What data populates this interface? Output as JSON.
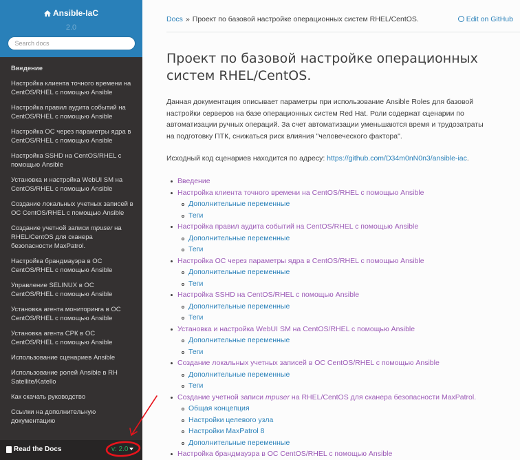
{
  "project": {
    "name": "Ansible-IaC",
    "version": "2.0"
  },
  "search": {
    "placeholder": "Search docs"
  },
  "sidebar": {
    "items": [
      {
        "label": "Введение",
        "bold": true
      },
      {
        "label": "Настройка клиента точного времени на CentOS/RHEL с помощью Ansible"
      },
      {
        "label": "Настройка правил аудита событий на CentOS/RHEL с помощью Ansible"
      },
      {
        "label": "Настройка ОС через параметры ядра в CentOS/RHEL с помощью Ansible"
      },
      {
        "label": "Настройка SSHD на CentOS/RHEL с помощью Ansible"
      },
      {
        "label": "Установка и настройка WebUI SM на CentOS/RHEL с помощью Ansible"
      },
      {
        "label": "Создание локальных учетных записей в ОС CentOS/RHEL с помощью Ansible"
      },
      {
        "label_before": "Создание учетной записи ",
        "label_em": "mpuser",
        "label_after": " на RHEL/CentOS для сканера безопасности MaxPatrol."
      },
      {
        "label": "Настройка брандмауэра в ОС CentOS/RHEL с помощью Ansible"
      },
      {
        "label": "Управление SELINUX в ОС CentOS/RHEL с помощью Ansible"
      },
      {
        "label": "Установка агента мониторинга в ОС CentOS/RHEL с помощью Ansible"
      },
      {
        "label": "Установка агента СРК в ОС CentOS/RHEL с помощью Ansible"
      },
      {
        "label": "Использование сценариев Ansible"
      },
      {
        "label": "Использование ролей Ansible в RH Satellite/Katello"
      },
      {
        "label": "Как скачать руководство"
      },
      {
        "label": "Ссылки на дополнительную документацию"
      }
    ]
  },
  "rtd": {
    "label": "Read the Docs",
    "version": "v: 2.0"
  },
  "breadcrumbs": {
    "root": "Docs",
    "separator": "»",
    "current": "Проект по базовой настройке операционных систем RHEL/CentOS."
  },
  "edit_link": "Edit on GitHub",
  "page": {
    "title": "Проект по базовой настройке операционных систем RHEL/CentOS.",
    "intro": "Данная документация описывает параметры при использование Ansible Roles для базовой настройки серверов на базе операционных систем Red Hat. Роли содержат сценарии по автоматизации ручных операций. За счет автоматизации уменьшаются время и трудозатраты на подготовку ПТК, снижаться риск влияния \"человеческого фактора\".",
    "source_text": "Исходный код сценариев находится по адресу: ",
    "source_url": "https://github.com/D34m0nN0n3/ansible-iac",
    "source_end": "."
  },
  "toc": [
    {
      "label": "Введение",
      "visited": true,
      "children": []
    },
    {
      "label": "Настройка клиента точного времени на CentOS/RHEL с помощью Ansible",
      "visited": true,
      "children": [
        "Дополнительные переменные",
        "Теги"
      ]
    },
    {
      "label": "Настройка правил аудита событий на CentOS/RHEL с помощью Ansible",
      "visited": true,
      "children": [
        "Дополнительные переменные",
        "Теги"
      ]
    },
    {
      "label": "Настройка ОС через параметры ядра в CentOS/RHEL с помощью Ansible",
      "visited": true,
      "children": [
        "Дополнительные переменные",
        "Теги"
      ]
    },
    {
      "label": "Настройка SSHD на CentOS/RHEL с помощью Ansible",
      "visited": true,
      "children": [
        "Дополнительные переменные",
        "Теги"
      ]
    },
    {
      "label": "Установка и настройка WebUI SM на CentOS/RHEL с помощью Ansible",
      "visited": true,
      "children": [
        "Дополнительные переменные",
        "Теги"
      ]
    },
    {
      "label": "Создание локальных учетных записей в ОС CentOS/RHEL с помощью Ansible",
      "visited": true,
      "children": [
        "Дополнительные переменные",
        "Теги"
      ]
    },
    {
      "label_before": "Создание учетной записи ",
      "label_em": "mpuser",
      "label_after": " на RHEL/CentOS для сканера безопасности MaxPatrol.",
      "visited": true,
      "children": [
        "Общая концепция",
        "Настройки целевого узла",
        "Настройки MaxPatrol 8",
        "Дополнительные переменные"
      ]
    },
    {
      "label": "Настройка брандмауэра в ОС CentOS/RHEL с помощью Ansible",
      "visited": true,
      "children": []
    }
  ],
  "colors": {
    "sidebar_bg": "#343131",
    "header_blue": "#2980b9",
    "link_blue": "#2980b9",
    "link_visited": "#9b59b6",
    "annotation_red": "#e8141c",
    "rtd_green": "#27ae60"
  },
  "icons": {
    "brand": "home-icon",
    "rtd": "book-icon",
    "edit": "github-icon",
    "annotation": "red-arrow-annotation"
  }
}
